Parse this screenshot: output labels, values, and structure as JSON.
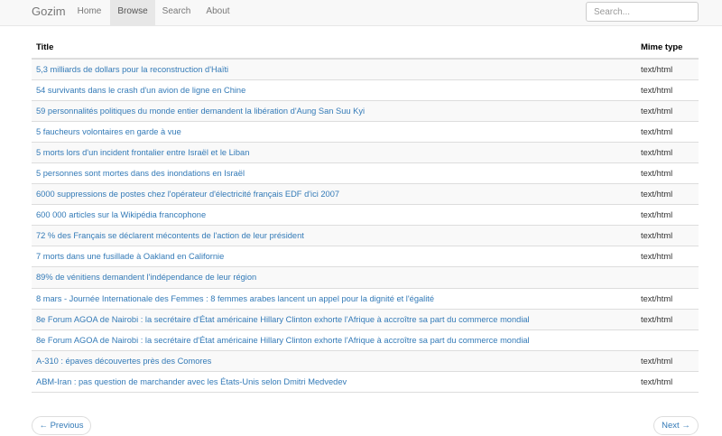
{
  "navbar": {
    "brand": "Gozim",
    "links": [
      "Home",
      "Browse",
      "Search",
      "About"
    ],
    "active": "Browse",
    "search_placeholder": "Search..."
  },
  "table": {
    "headers": {
      "title": "Title",
      "mime": "Mime type"
    },
    "rows": [
      {
        "title": "5,3 milliards de dollars pour la reconstruction d'Haïti",
        "mime": "text/html"
      },
      {
        "title": "54 survivants dans le crash d'un avion de ligne en Chine",
        "mime": "text/html"
      },
      {
        "title": "59 personnalités politiques du monde entier demandent la libération d'Aung San Suu Kyi",
        "mime": "text/html"
      },
      {
        "title": "5 faucheurs volontaires en garde à vue",
        "mime": "text/html"
      },
      {
        "title": "5 morts lors d'un incident frontalier entre Israël et le Liban",
        "mime": "text/html"
      },
      {
        "title": "5 personnes sont mortes dans des inondations en Israël",
        "mime": "text/html"
      },
      {
        "title": "6000 suppressions de postes chez l'opérateur d'électricité français EDF d'ici 2007",
        "mime": "text/html"
      },
      {
        "title": "600 000 articles sur la Wikipédia francophone",
        "mime": "text/html"
      },
      {
        "title": "72 % des Français se déclarent mécontents de l'action de leur président",
        "mime": "text/html"
      },
      {
        "title": "7 morts dans une fusillade à Oakland en Californie",
        "mime": "text/html"
      },
      {
        "title": "89% de vénitiens demandent l'indépendance de leur région",
        "mime": ""
      },
      {
        "title": "8 mars - Journée Internationale des Femmes : 8 femmes arabes lancent un appel pour la dignité et l'égalité",
        "mime": "text/html"
      },
      {
        "title": "8e Forum AGOA de Nairobi : la secrétaire d'État américaine Hillary Clinton exhorte l'Afrique à accroître sa part du commerce mondial",
        "mime": "text/html"
      },
      {
        "title": "8e Forum AGOA de Nairobi : la secrétaire d'État américaine Hillary Clinton exhorte l'Afrique à accroître sa part du commerce mondial",
        "mime": ""
      },
      {
        "title": "A-310 : épaves découvertes près des Comores",
        "mime": "text/html"
      },
      {
        "title": "ABM-Iran : pas question de marchander avec les États-Unis selon Dmitri Medvedev",
        "mime": "text/html"
      }
    ]
  },
  "pager": {
    "previous": "← Previous",
    "next": "Next →"
  }
}
